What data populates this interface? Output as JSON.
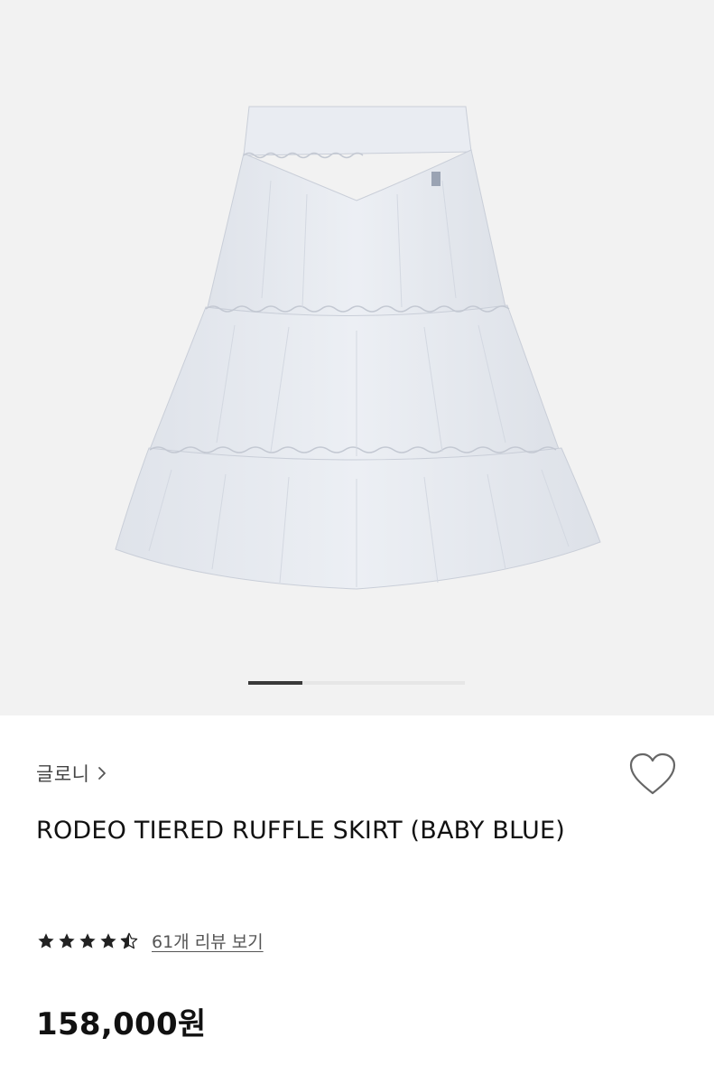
{
  "gallery": {
    "image_alt": "skirt-product-photo",
    "slide_index": 1,
    "background": "#f2f2f2",
    "skirt_color": "#e6eaf1"
  },
  "product": {
    "brand": "글로니",
    "title": "RODEO TIERED RUFFLE SKIRT (BABY BLUE)",
    "rating": 4.5,
    "review_link": "61개 리뷰 보기",
    "price": "158,000원"
  },
  "icons": {
    "brand_chevron": "chevron-right-icon",
    "wishlist": "heart-outline-icon",
    "star": "star-icon"
  }
}
